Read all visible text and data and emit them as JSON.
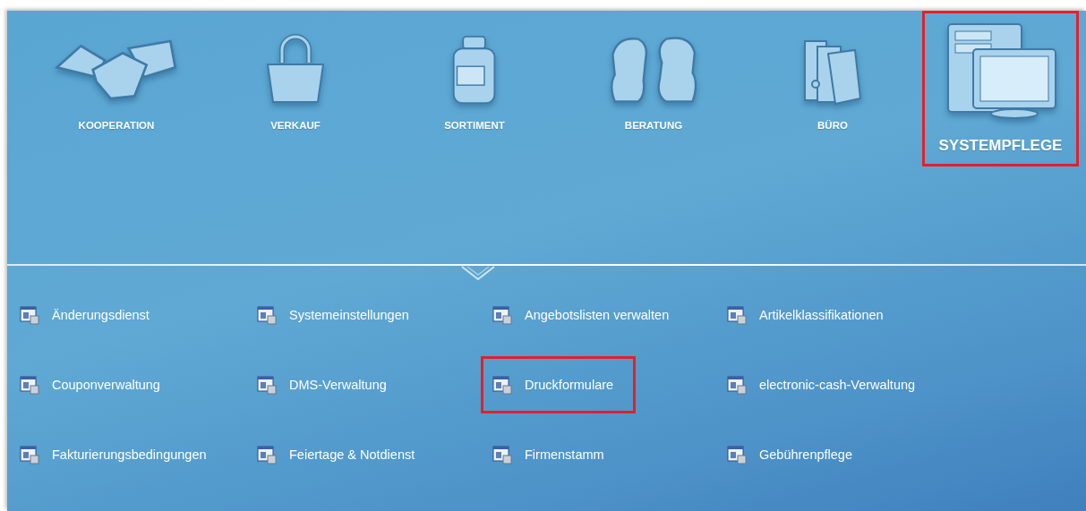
{
  "categories": [
    {
      "label": "KOOPERATION",
      "selected": false,
      "highlighted": false
    },
    {
      "label": "VERKAUF",
      "selected": false,
      "highlighted": false
    },
    {
      "label": "SORTIMENT",
      "selected": false,
      "highlighted": false
    },
    {
      "label": "BERATUNG",
      "selected": false,
      "highlighted": false
    },
    {
      "label": "BÜRO",
      "selected": false,
      "highlighted": false
    },
    {
      "label": "SYSTEMPFLEGE",
      "selected": true,
      "highlighted": true
    }
  ],
  "menu_items": [
    {
      "label": "Änderungsdienst",
      "highlighted": false
    },
    {
      "label": "Systemeinstellungen",
      "highlighted": false
    },
    {
      "label": "Angebotslisten verwalten",
      "highlighted": false
    },
    {
      "label": "Artikelklassifikationen",
      "highlighted": false
    },
    {
      "label": "Couponverwaltung",
      "highlighted": false
    },
    {
      "label": "DMS-Verwaltung",
      "highlighted": false
    },
    {
      "label": "Druckformulare",
      "highlighted": true
    },
    {
      "label": "electronic-cash-Verwaltung",
      "highlighted": false
    },
    {
      "label": "Fakturierungsbedingungen",
      "highlighted": false
    },
    {
      "label": "Feiertage & Notdienst",
      "highlighted": false
    },
    {
      "label": "Firmenstamm",
      "highlighted": false
    },
    {
      "label": "Gebührenpflege",
      "highlighted": false
    }
  ]
}
